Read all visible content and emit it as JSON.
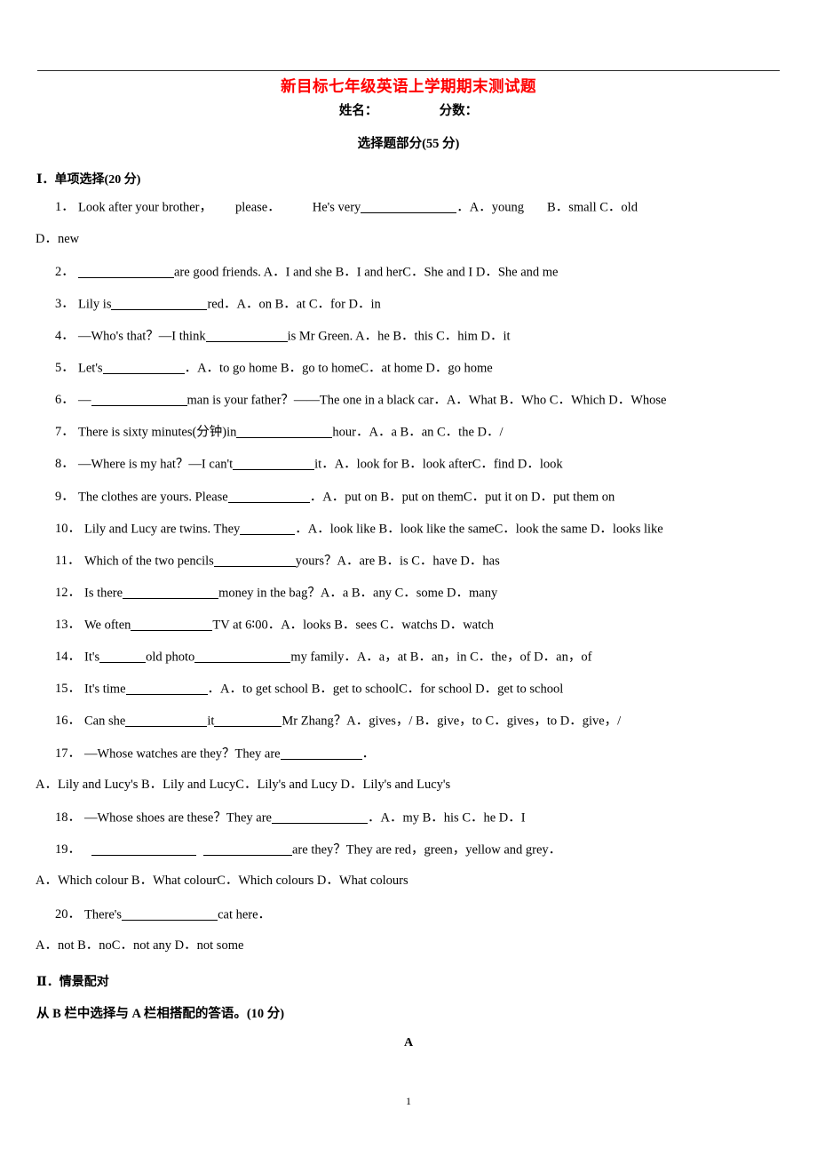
{
  "header": {
    "title": "新目标七年级英语上学期期末测试题",
    "name_label": "姓名：",
    "score_label": "分数：",
    "part_title": "选择题部分(55 分)",
    "title_color": "#ff0000"
  },
  "sections": [
    {
      "heading": "Ⅰ．单项选择(20 分)"
    },
    {
      "heading": "Ⅱ．情景配对",
      "subheading": "从 B 栏中选择与 A 栏相搭配的答语。(10 分)",
      "column_label": "A"
    }
  ],
  "questions": [
    {
      "num": "1．",
      "parts": [
        "Look after your brother，",
        "please．",
        "He's very"
      ],
      "tail": "．A．young",
      "options_inline": "B．small        C．old",
      "wrapped": "D．new"
    },
    {
      "num": "2．",
      "text": "are good friends. A．I and she        B．I and herC．She and I        D．She and me"
    },
    {
      "num": "3．",
      "text": "Lily is",
      "tail": "red．A．on      B．at      C．for      D．in"
    },
    {
      "num": "4．",
      "text": "—Who's that？—I think",
      "tail": "is Mr Green. A．he       B．this      C．him      D．it"
    },
    {
      "num": "5．",
      "text": "Let's",
      "tail": "．A．to go home        B．go to homeC．at home          D．go home"
    },
    {
      "num": "6．",
      "text": "—",
      "tail": "man is your father？——The one in a black car．A．What       B．Who      C．Which      D．Whose"
    },
    {
      "num": "7．",
      "text": "There is sixty minutes(分钟)in",
      "tail": "hour．A．a       B．an       C．the       D．/"
    },
    {
      "num": "8．",
      "text": "—Where is my hat？—I can't",
      "tail": "it．A．look for        B．look afterC．find           D．look"
    },
    {
      "num": "9．",
      "text": "The clothes are yours.    Please",
      "tail": "．A．put on          B．put on themC．put it on      D．put them on"
    },
    {
      "num": "10．",
      "text": "Lily and Lucy are twins. They",
      "tail": "．A．look like     B．look like the sameC．look the same      D．looks like"
    },
    {
      "num": "11．",
      "text": "Which of the two pencils",
      "tail": "yours？A．are      B．is      C．have      D．has"
    },
    {
      "num": "12．",
      "text": "Is there",
      "tail": "money in the bag？A．a B．any       C．some       D．many"
    },
    {
      "num": "13．",
      "text": "We often",
      "tail": "TV at 6∶00．A．looks       B．sees       C．watchs       D．watch"
    },
    {
      "num": "14．",
      "text": "It's",
      "mid": "old photo",
      "tail": "my family．A．a，at       B．an，in       C．the，of      D．an，of"
    },
    {
      "num": "15．",
      "text": "It's time",
      "tail": "．A．to get school       B．get to schoolC．for school          D．get to school"
    },
    {
      "num": "16．",
      "text": "Can she",
      "mid": "it",
      "tail": "Mr Zhang？A．gives，/         B．give，to   C．gives，to   D．give，/"
    },
    {
      "num": "17．",
      "text": "—Whose watches are they？They are",
      "tail": "．",
      "wrapped": "A．Lily and Lucy's       B．Lily and LucyC．Lily's and Lucy      D．Lily's and Lucy's"
    },
    {
      "num": "18．",
      "text": "—Whose shoes are these？They are",
      "tail": "．A．my       B．his       C．he       D．I"
    },
    {
      "num": "19．",
      "text": "",
      "tail": "are they？They are red，green，yellow and grey．",
      "wrapped": "A．Which colour        B．What colourC．Which colours        D．What    colours"
    },
    {
      "num": "20．",
      "text": "There's",
      "tail": "cat here．",
      "wrapped": "A．not          B．noC．not any      D．not some"
    }
  ],
  "footer": {
    "page_number": "1"
  }
}
